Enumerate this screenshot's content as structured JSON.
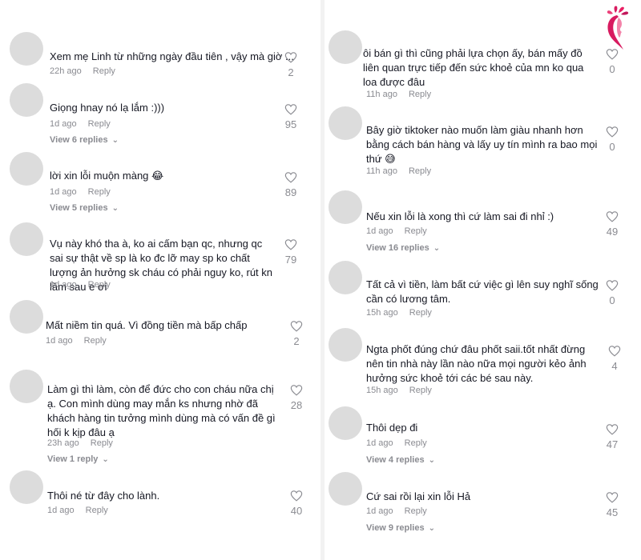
{
  "brand": {
    "logo_icon": "lotus-face-logo",
    "accent": "#d81b60"
  },
  "left_comments": [
    {
      "text": "Xem mẹ Linh từ những ngày đầu tiên , vậy mà giờ ...",
      "time": "22h ago",
      "reply": "Reply",
      "likes": "2",
      "view_replies": ""
    },
    {
      "text": "Giọng hnay nó lạ lắm :)))",
      "time": "1d ago",
      "reply": "Reply",
      "likes": "95",
      "view_replies": "View 6 replies"
    },
    {
      "text": "lời xin lỗi muộn màng 😂",
      "time": "1d ago",
      "reply": "Reply",
      "likes": "89",
      "view_replies": "View 5 replies"
    },
    {
      "text": "Vụ này khó tha à, ko ai cấm bạn qc, nhưng qc sai sự thật về sp là ko đc lỡ may sp ko chất lượng ản hưởng sk cháu có phải nguy ko, rút kn lầm sau e ơi",
      "time": "1d ago",
      "reply": "Reply",
      "likes": "79",
      "view_replies": ""
    },
    {
      "text": "Mất niềm tin quá. Vì đồng tiền mà bấp chấp",
      "time": "1d ago",
      "reply": "Reply",
      "likes": "2",
      "view_replies": ""
    },
    {
      "text": "Làm gì thì làm, còn để đức cho con cháu nữa chị ạ. Con mình dùng may mắn ks nhưng nhờ đã khách hàng tin tưởng mình dùng mà có vấn đề gì hối k kịp đâu ạ",
      "time": "23h ago",
      "reply": "Reply",
      "likes": "28",
      "view_replies": "View 1 reply"
    },
    {
      "text": "Thôi né từ đây cho lành.",
      "time": "1d ago",
      "reply": "Reply",
      "likes": "40",
      "view_replies": ""
    }
  ],
  "right_comments": [
    {
      "text": "ôi bán gì thì cũng phải lựa chọn ấy, bán mấy đồ liên quan trực tiếp đến sức khoẻ của mn ko qua loa được đâu",
      "time": "11h ago",
      "reply": "Reply",
      "likes": "0",
      "view_replies": ""
    },
    {
      "text": "Bây giờ tiktoker nào muốn làm giàu nhanh hơn bằng cách bán hàng và lấy uy tín mình ra bao mọi thứ 😅",
      "time": "11h ago",
      "reply": "Reply",
      "likes": "0",
      "view_replies": ""
    },
    {
      "text": "Nếu xin lỗi là xong thì cứ làm sai đi nhỉ :)",
      "time": "1d ago",
      "reply": "Reply",
      "likes": "49",
      "view_replies": "View 16 replies"
    },
    {
      "text": "Tất cả vì tiền, làm bất cứ việc gì lên suy nghĩ sống cần có lương tâm.",
      "time": "15h ago",
      "reply": "Reply",
      "likes": "0",
      "view_replies": ""
    },
    {
      "text": "Ngta phốt đúng chứ đâu phốt saii.tốt nhất đừng nên tin nhà này lần nào nữa mọi người kẻo ảnh hưởng sức khoẻ tới các bé sau này.",
      "time": "15h ago",
      "reply": "Reply",
      "likes": "4",
      "view_replies": ""
    },
    {
      "text": "Thôi dẹp đi",
      "time": "1d ago",
      "reply": "Reply",
      "likes": "47",
      "view_replies": "View 4 replies"
    },
    {
      "text": "Cứ sai rồi lại xin lỗi Hả",
      "time": "1d ago",
      "reply": "Reply",
      "likes": "45",
      "view_replies": "View 9 replies"
    }
  ]
}
